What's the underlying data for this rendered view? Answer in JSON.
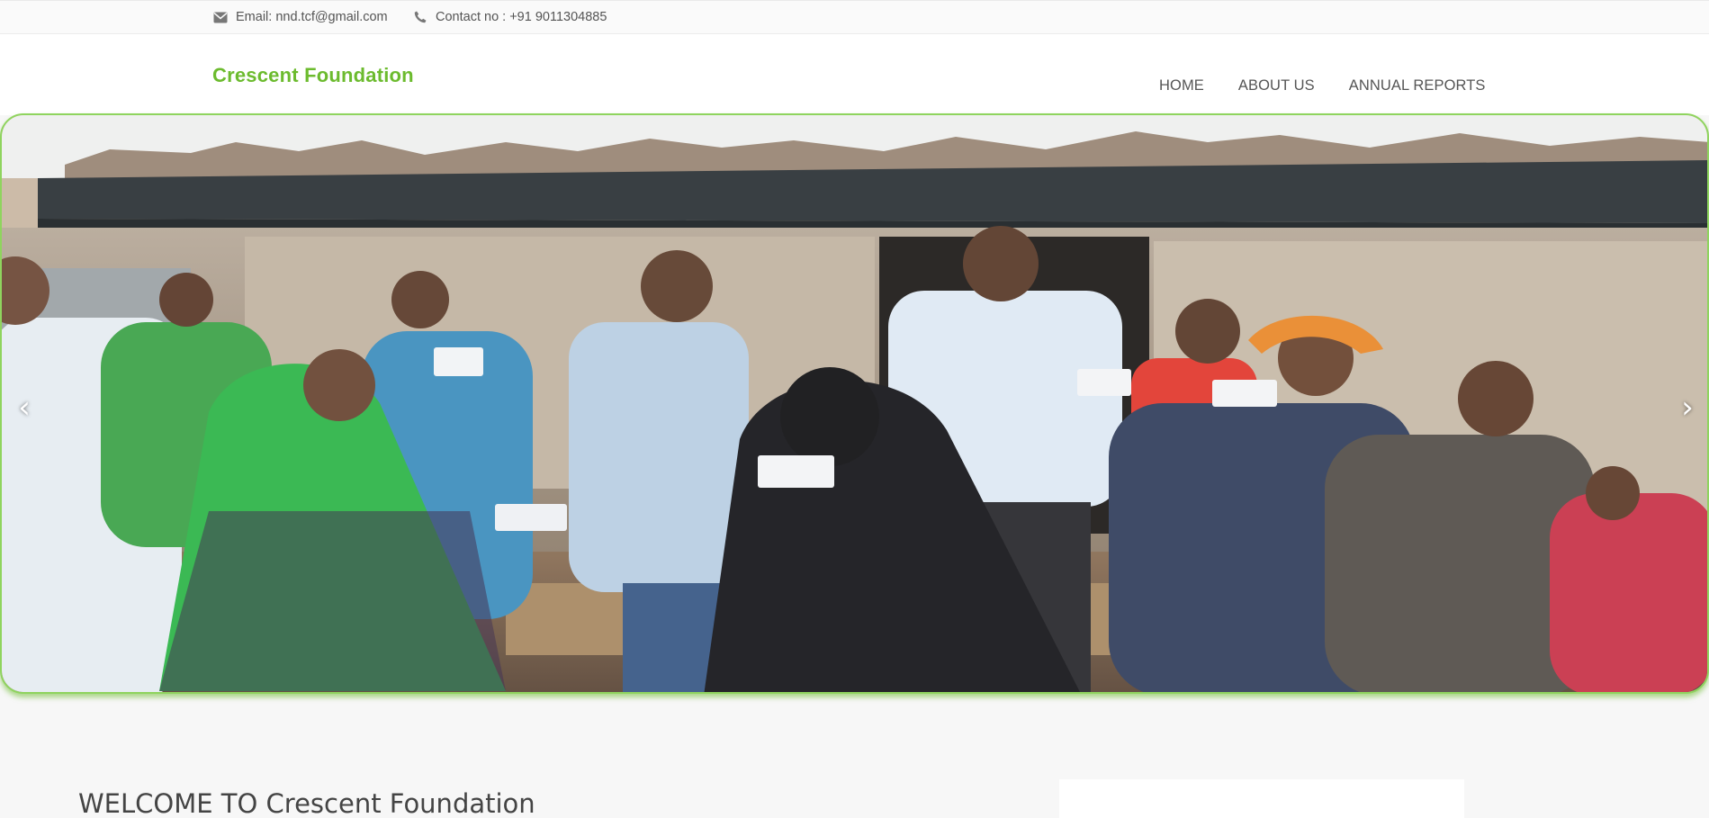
{
  "topbar": {
    "email_text": "Email: nnd.tcf@gmail.com",
    "email_icon": "envelope-icon",
    "phone_text": "Contact no : +91 9011304885",
    "phone_icon": "phone-icon"
  },
  "header": {
    "brand": "Crescent Foundation",
    "nav": [
      {
        "label": "HOME"
      },
      {
        "label": "ABOUT US"
      },
      {
        "label": "ANNUAL REPORTS"
      }
    ]
  },
  "slider": {
    "prev_label": "‹",
    "next_label": "›",
    "image_description_icon": "photo-slide-icon"
  },
  "welcome": {
    "title": "WELCOME TO Crescent Foundation"
  },
  "colors": {
    "brand": "#6cbb2e",
    "slider_border": "#8fd45e",
    "page_bg": "#f7f7f7"
  }
}
